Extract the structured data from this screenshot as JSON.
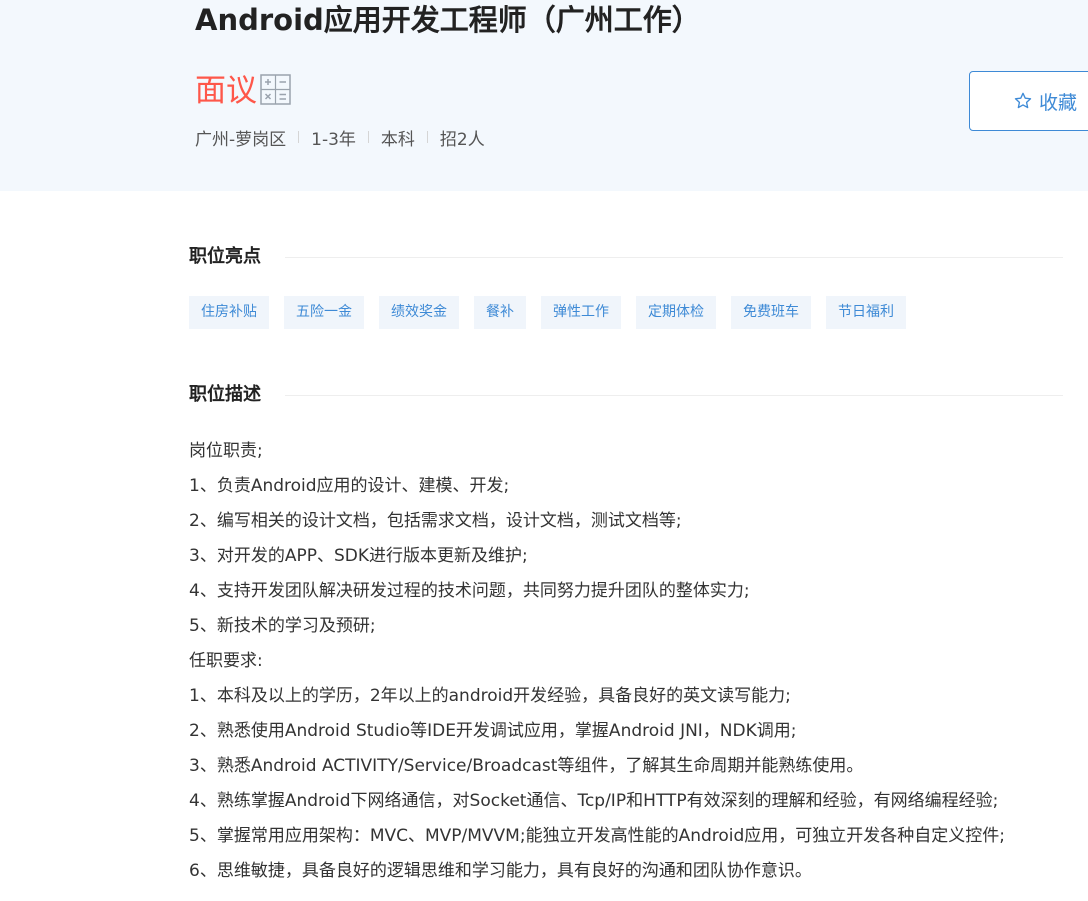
{
  "job": {
    "title": "Android应用开发工程师（广州工作）",
    "salary": "面议",
    "meta": [
      "广州-萝岗区",
      "1-3年",
      "本科",
      "招2人"
    ]
  },
  "actions": {
    "favorite_label": "收藏"
  },
  "highlights": {
    "title": "职位亮点",
    "tags": [
      "住房补贴",
      "五险一金",
      "绩效奖金",
      "餐补",
      "弹性工作",
      "定期体检",
      "免费班车",
      "节日福利"
    ]
  },
  "description": {
    "title": "职位描述",
    "lines": [
      "岗位职责;",
      "1、负责Android应用的设计、建模、开发;",
      "2、编写相关的设计文档，包括需求文档，设计文档，测试文档等;",
      "3、对开发的APP、SDK进行版本更新及维护;",
      "4、支持开发团队解决研发过程的技术问题，共同努力提升团队的整体实力;",
      "5、新技术的学习及预研;",
      "任职要求:",
      "1、本科及以上的学历，2年以上的android开发经验，具备良好的英文读写能力;",
      "2、熟悉使用Android Studio等IDE开发调试应用，掌握Android JNI，NDK调用;",
      "3、熟悉Android ACTIVITY/Service/Broadcast等组件，了解其生命周期并能熟练使用。",
      "4、熟练掌握Android下网络通信，对Socket通信、Tcp/IP和HTTP有效深刻的理解和经验，有网络编程经验;",
      "5、掌握常用应用架构：MVC、MVP/MVVM;能独立开发高性能的Android应用，可独立开发各种自定义控件;",
      "6、思维敏捷，具备良好的逻辑思维和学习能力，具有良好的沟通和团队协作意识。"
    ]
  },
  "colors": {
    "accent": "#3e8ad6",
    "salary": "#fe574a",
    "header_bg": "#f3f8fd",
    "tag_bg": "#f0f5fb"
  },
  "icons": {
    "calculator": "calculator-icon",
    "favorite": "star-icon"
  }
}
